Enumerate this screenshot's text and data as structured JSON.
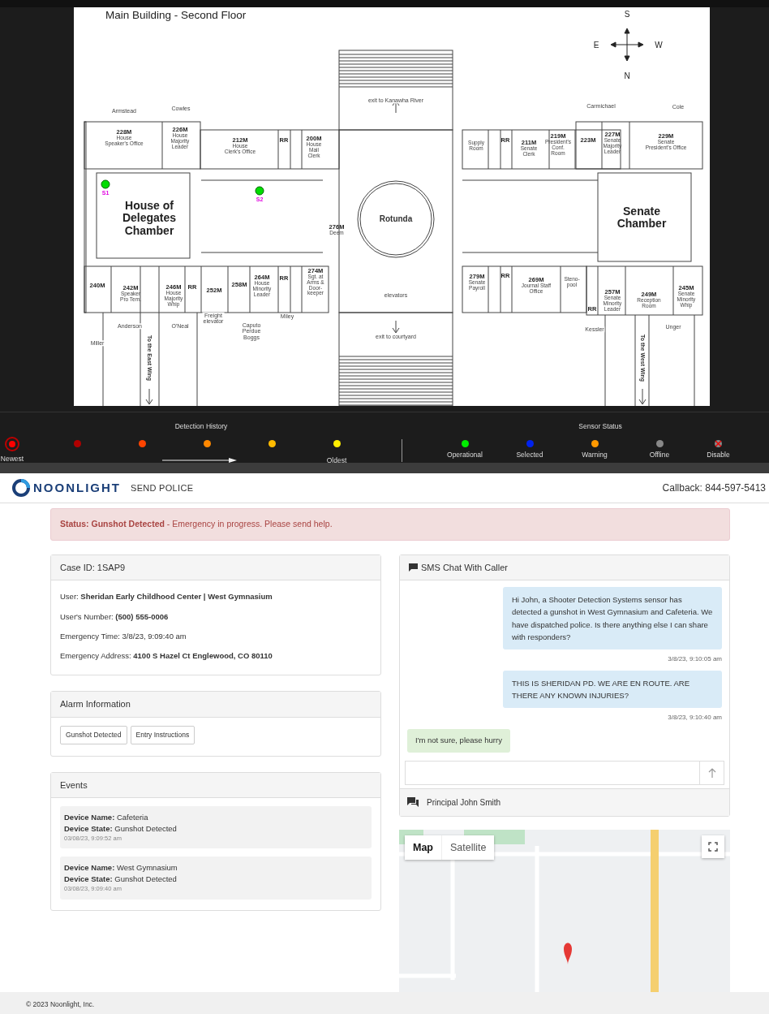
{
  "floor_plan": {
    "title": "Main Building - Second Floor",
    "compass": [
      "S",
      "E",
      "W",
      "N"
    ],
    "rooms": [
      {
        "kind": "room",
        "number": "228M",
        "name": "House\nSpeaker's Office"
      },
      {
        "kind": "room",
        "number": "226M",
        "name": "House\nMajority\nLeader"
      },
      {
        "kind": "room",
        "number": "212M",
        "name": "House\nClerk's Office"
      },
      {
        "kind": "room",
        "number": "RR"
      },
      {
        "kind": "room",
        "number": "200M",
        "name": "House\nMail\nClerk"
      },
      {
        "kind": "room",
        "name": "Supply\nRoom"
      },
      {
        "kind": "room",
        "number": "RR"
      },
      {
        "kind": "room",
        "number": "211M",
        "name": "Senate\nClerk"
      },
      {
        "kind": "room",
        "number": "219M",
        "name": "President's\nConf.\nRoom"
      },
      {
        "kind": "room",
        "number": "223M"
      },
      {
        "kind": "room",
        "number": "227M",
        "name": "Senate\nMajority\nLeader"
      },
      {
        "kind": "room",
        "number": "229M",
        "name": "Senate\nPresident's Office"
      },
      {
        "kind": "chamber",
        "name": "House of\nDelegates\nChamber"
      },
      {
        "kind": "hall",
        "name": "Rotunda"
      },
      {
        "kind": "chamber",
        "name": "Senate\nChamber"
      },
      {
        "kind": "room",
        "number": "276M",
        "name": "Deem"
      },
      {
        "kind": "room",
        "number": "240M"
      },
      {
        "kind": "room",
        "number": "242M",
        "name": "Speaker\nPro Tem."
      },
      {
        "kind": "room",
        "number": "246M",
        "name": "House\nMajority\nWhip"
      },
      {
        "kind": "room",
        "number": "RR"
      },
      {
        "kind": "room",
        "number": "252M"
      },
      {
        "kind": "room",
        "number": "258M"
      },
      {
        "kind": "room",
        "number": "264M",
        "name": "House\nMinority\nLeader"
      },
      {
        "kind": "room",
        "number": "RR"
      },
      {
        "kind": "room",
        "number": "274M",
        "name": "Sgt. at\nArms &\nDoor-\nkeeper"
      },
      {
        "kind": "room",
        "number": "279M",
        "name": "Senate\nPayroll"
      },
      {
        "kind": "room",
        "number": "RR"
      },
      {
        "kind": "room",
        "number": "269M",
        "name": "Journal Staff\nOffice"
      },
      {
        "kind": "room",
        "name": "Steno-\npool"
      },
      {
        "kind": "room",
        "number": "RR"
      },
      {
        "kind": "room",
        "number": "257M",
        "name": "Senate\nMinority\nLeader"
      },
      {
        "kind": "room",
        "number": "249M",
        "name": "Reception\nRoom"
      },
      {
        "kind": "room",
        "number": "245M",
        "name": "Senate\nMinority\nWhip"
      }
    ],
    "notes": [
      {
        "kind": "text",
        "text": "Armstead"
      },
      {
        "kind": "text",
        "text": "Cowles"
      },
      {
        "kind": "text",
        "text": "Carmichael"
      },
      {
        "kind": "text",
        "text": "Cole"
      },
      {
        "kind": "text",
        "text": "exit to Kanawha River"
      },
      {
        "kind": "text",
        "text": "Miller"
      },
      {
        "kind": "text",
        "text": "Anderson"
      },
      {
        "kind": "text",
        "text": "O'Neal"
      },
      {
        "kind": "text",
        "text": "Freight\nelevator"
      },
      {
        "kind": "text",
        "text": "Caputo\nPerdue\nBoggs"
      },
      {
        "kind": "text",
        "text": "Miley"
      },
      {
        "kind": "text",
        "text": "elevators"
      },
      {
        "kind": "text",
        "text": "exit to courtyard"
      },
      {
        "kind": "text",
        "text": "Kessler"
      },
      {
        "kind": "text",
        "text": "Unger"
      },
      {
        "kind": "vertical",
        "text": "To the East Wing"
      },
      {
        "kind": "vertical",
        "text": "To the West Wing"
      }
    ],
    "sensors": [
      {
        "label": "S1",
        "color": "#00dd00"
      },
      {
        "label": "S2",
        "color": "#00dd00"
      }
    ]
  },
  "legend": {
    "history_title": "Detection History",
    "history": [
      {
        "kind": "ring",
        "color": "#ff0000",
        "label": "Newest"
      },
      {
        "kind": "dot",
        "color": "#b00000"
      },
      {
        "kind": "dot",
        "color": "#ff4400"
      },
      {
        "kind": "dot",
        "color": "#ff8800"
      },
      {
        "kind": "dot",
        "color": "#ffbb00"
      },
      {
        "kind": "dot",
        "color": "#ffee00",
        "label": "Oldest"
      }
    ],
    "status_title": "Sensor Status",
    "statuses": [
      {
        "kind": "dot",
        "color": "#00ee00",
        "label": "Operational"
      },
      {
        "kind": "dot",
        "color": "#0022ee",
        "label": "Selected"
      },
      {
        "kind": "dot",
        "color": "#ff9900",
        "label": "Warning"
      },
      {
        "kind": "dot",
        "color": "#888888",
        "label": "Offline"
      },
      {
        "kind": "crossed",
        "color": "#888888",
        "label": "Disable"
      }
    ]
  },
  "header": {
    "brand": "NOONLIGHT",
    "section": "SEND POLICE",
    "callback": "Callback: 844-597-5413"
  },
  "alert": "**Status: Gunshot Detected** - Emergency in progress. Please send help.",
  "case": {
    "title": "Case ID: 1SAP9",
    "lines": [
      "User: **Sheridan Early Childhood Center | West Gymnasium**",
      "User's Number: **(500) 555-0006**",
      "Emergency Time: 3/8/23, 9:09:40 am",
      "Emergency Address: **4100 S Hazel Ct Englewood, CO 80110**"
    ]
  },
  "alarm": {
    "title": "Alarm Information",
    "buttons": [
      "Gunshot Detected",
      "Entry Instructions"
    ]
  },
  "events": {
    "title": "Events",
    "items": [
      {
        "name": "**Device Name:** Cafeteria",
        "state": "**Device State:** Gunshot Detected",
        "time": "03/08/23, 9:09:52 am"
      },
      {
        "name": "**Device Name:** West Gymnasium",
        "state": "**Device State:** Gunshot Detected",
        "time": "03/08/23, 9:09:40 am"
      }
    ]
  },
  "chat": {
    "title": "SMS Chat With Caller",
    "messages": [
      {
        "kind": "outgoing",
        "text": "Hi John, a Shooter Detection Systems sensor has detected a gunshot in West Gymnasium and Cafeteria. We have dispatched police. Is there anything else I can share with responders?",
        "time": "3/8/23, 9:10:05 am"
      },
      {
        "kind": "outgoing",
        "text": "THIS IS SHERIDAN PD. WE ARE EN ROUTE. ARE THERE ANY KNOWN INJURIES?",
        "time": "3/8/23, 9:10:40 am"
      },
      {
        "kind": "incoming",
        "text": "I'm not sure, please hurry"
      }
    ],
    "contact": "Principal John Smith"
  },
  "map": {
    "tabs": [
      {
        "label": "Map",
        "selected": true
      },
      {
        "label": "Satellite",
        "selected": false
      }
    ]
  },
  "footer": "© 2023 Noonlight, Inc."
}
